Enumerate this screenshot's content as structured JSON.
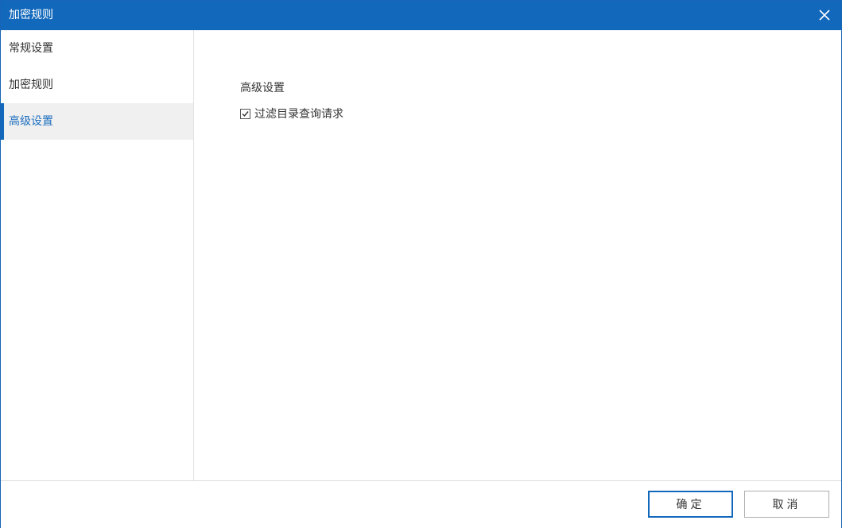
{
  "window": {
    "title": "加密规则"
  },
  "sidebar": {
    "items": [
      {
        "label": "常规设置",
        "active": false
      },
      {
        "label": "加密规则",
        "active": false
      },
      {
        "label": "高级设置",
        "active": true
      }
    ]
  },
  "content": {
    "section_title": "高级设置",
    "checkbox": {
      "label": "过滤目录查询请求",
      "checked": true
    }
  },
  "footer": {
    "ok_label": "确定",
    "cancel_label": "取消"
  },
  "colors": {
    "accent": "#1268bb",
    "active_text": "#1e6fbf",
    "active_bg": "#f0f0f0"
  },
  "icons": {
    "close": "close-icon",
    "check": "checkmark-icon"
  }
}
